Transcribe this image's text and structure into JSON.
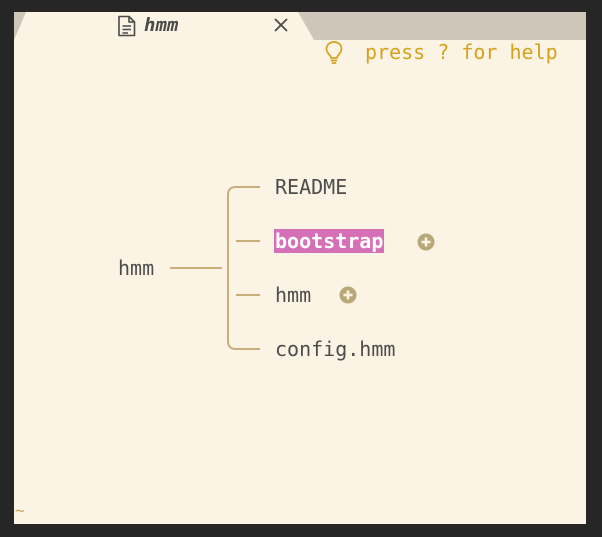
{
  "tab": {
    "title": "hmm",
    "file_icon": "file-text-icon",
    "close_icon": "close-icon"
  },
  "help": {
    "icon": "lightbulb-icon",
    "text": "press ? for help"
  },
  "tree": {
    "root": {
      "label": "hmm"
    },
    "children": [
      {
        "label": "README",
        "selected": false,
        "collapsed_children": false
      },
      {
        "label": "bootstrap",
        "selected": true,
        "collapsed_children": true
      },
      {
        "label": "hmm",
        "selected": false,
        "collapsed_children": true
      },
      {
        "label": "config.hmm",
        "selected": false,
        "collapsed_children": false
      }
    ]
  },
  "editor": {
    "empty_line_marker": "~"
  },
  "colors": {
    "background": "#fbf3e3",
    "tabbar": "#cdc6b9",
    "frame": "#262626",
    "connector": "#c9b07a",
    "selection": "#d670b6",
    "help_text": "#d6a21d",
    "expand_icon": "#b9a877",
    "tilde": "#c9a557"
  }
}
